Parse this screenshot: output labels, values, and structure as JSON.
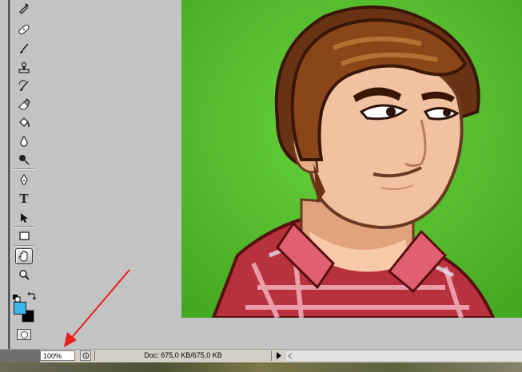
{
  "toolbox": {
    "tools": [
      {
        "name": "eyedropper-tool",
        "icon": "eyedropper-icon"
      },
      {
        "name": "healing-brush-tool",
        "icon": "bandage-icon"
      },
      {
        "name": "brush-tool",
        "icon": "brush-icon"
      },
      {
        "name": "clone-stamp-tool",
        "icon": "stamp-icon"
      },
      {
        "name": "history-brush-tool",
        "icon": "history-brush-icon"
      },
      {
        "name": "eraser-tool",
        "icon": "eraser-icon"
      },
      {
        "name": "paint-bucket-tool",
        "icon": "bucket-icon"
      },
      {
        "name": "blur-tool",
        "icon": "drop-icon"
      },
      {
        "name": "dodge-tool",
        "icon": "dodge-icon"
      },
      {
        "name": "pen-tool",
        "icon": "pen-icon"
      },
      {
        "name": "type-tool",
        "icon": "type-icon"
      },
      {
        "name": "path-selection-tool",
        "icon": "arrow-icon"
      },
      {
        "name": "rectangle-tool",
        "icon": "rectangle-icon"
      },
      {
        "name": "hand-tool",
        "icon": "hand-icon",
        "active": true
      },
      {
        "name": "zoom-tool",
        "icon": "magnifier-icon"
      }
    ],
    "type_glyph": "T",
    "foreground_color": "#3cb4ec",
    "background_color": "#000000"
  },
  "canvas": {
    "image": "cartoon-man-portrait",
    "background_color": "#4cb82c"
  },
  "statusbar": {
    "zoom": "100%",
    "doc_info": "Doc: 675,0 KB/675,0 KB"
  },
  "annotation": {
    "arrow_color": "#e8201c"
  }
}
